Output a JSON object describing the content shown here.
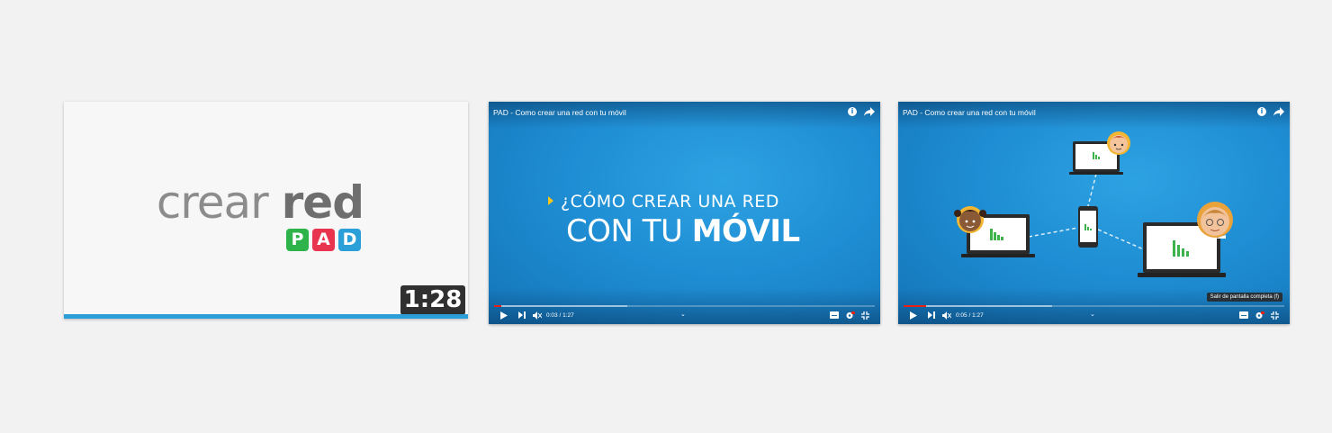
{
  "thumbnail": {
    "logo_word1": "crear",
    "logo_word2": "red",
    "badges": [
      {
        "letter": "P",
        "color": "#2db34a"
      },
      {
        "letter": "A",
        "color": "#e8344e"
      },
      {
        "letter": "D",
        "color": "#2a9fd8"
      }
    ],
    "duration": "1:28",
    "progress": 1.0
  },
  "player1": {
    "title": "PAD - Como crear una red con tu móvil",
    "headline_line1": "¿CÓMO CREAR UNA RED",
    "headline_line2_regular": "CON TU ",
    "headline_line2_bold": "MÓVIL",
    "time": "0:03 / 1:27",
    "played_fraction": 0.02,
    "loaded_fraction": 0.35
  },
  "player2": {
    "title": "PAD - Como crear una red con tu móvil",
    "time": "0:05 / 1:27",
    "played_fraction": 0.06,
    "loaded_fraction": 0.39,
    "tooltip": "Salir de pantalla completa (f)"
  },
  "icons": {
    "info": "i",
    "chevron": "⌄",
    "accent": "#f5c518",
    "progress_red": "#e62117",
    "bar_green": "#3cb44b"
  }
}
